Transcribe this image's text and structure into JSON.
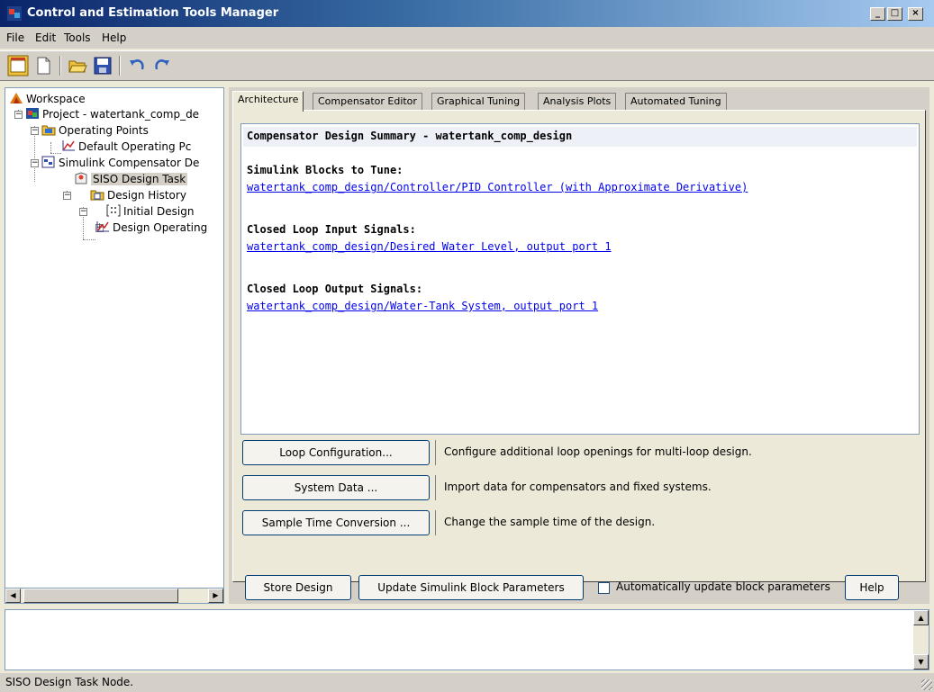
{
  "window": {
    "title": "Control and Estimation Tools Manager",
    "minimize": "_",
    "maximize": "□",
    "close": "×"
  },
  "menu": [
    "File",
    "Edit",
    "Tools",
    "Help"
  ],
  "toolbar": {
    "icons": [
      "new-task-icon",
      "new-file-icon",
      "open-icon",
      "save-icon",
      "undo-icon",
      "redo-icon"
    ]
  },
  "tree": {
    "items": [
      {
        "label": "Workspace",
        "icon": "workspace-icon"
      },
      {
        "label": "Project - watertank_comp_de",
        "icon": "project-icon"
      },
      {
        "label": "Operating Points",
        "icon": "folder-icon"
      },
      {
        "label": "Default Operating Pc",
        "icon": "plot-icon"
      },
      {
        "label": "Simulink Compensator De",
        "icon": "compensator-icon"
      },
      {
        "label": "SISO Design Task",
        "icon": "task-icon"
      },
      {
        "label": "Design History",
        "icon": "history-icon"
      },
      {
        "label": "Initial Design",
        "icon": "design-icon"
      },
      {
        "label": "Design Operating",
        "icon": "plot-icon"
      }
    ]
  },
  "tabs": [
    "Architecture",
    "Compensator Editor",
    "Graphical Tuning",
    "Analysis Plots",
    "Automated Tuning"
  ],
  "summary": {
    "header": "Compensator Design Summary - watertank_comp_design",
    "blocks_label": "Simulink Blocks to Tune:",
    "blocks_link": "watertank_comp_design/Controller/PID Controller (with Approximate Derivative)",
    "inputs_label": "Closed Loop Input Signals:",
    "inputs_link": "watertank_comp_design/Desired Water Level, output port 1",
    "outputs_label": "Closed Loop Output Signals:",
    "outputs_link": "watertank_comp_design/Water-Tank System, output port 1"
  },
  "config": {
    "loop_button": "Loop Configuration...",
    "loop_desc": "Configure additional loop openings for multi-loop design.",
    "sysdata_button": "System Data ...",
    "sysdata_desc": "Import data for compensators and fixed systems.",
    "sample_button": "Sample Time Conversion ...",
    "sample_desc": "Change the sample time of the design."
  },
  "bottom": {
    "store": "Store Design",
    "update": "Update Simulink Block Parameters",
    "auto_label": "Automatically update block parameters",
    "help": "Help"
  },
  "status": "SISO Design Task Node."
}
